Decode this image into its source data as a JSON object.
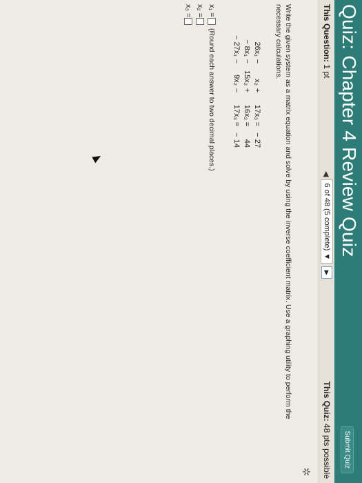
{
  "header": {
    "title": "Quiz: Chapter 4 Review Quiz",
    "submit_label": "Submit Quiz"
  },
  "status": {
    "question_label": "This Question:",
    "question_points": "1 pt",
    "position_text": "6 of 48 (5 complete)",
    "quiz_label": "This Quiz:",
    "quiz_points": "48 pts possible"
  },
  "question": {
    "instructions": "Write the given system as a matrix equation and solve by using the inverse coefficient matrix. Use a graphing utility to perform the necessary calculations.",
    "equations": [
      {
        "c1": "26x₁",
        "op1": "−",
        "c2": "x₂",
        "op2": "+",
        "c3": "17x₃",
        "eq": "=",
        "rhs": "− 27"
      },
      {
        "c1": "− 8x₁",
        "op1": "−",
        "c2": "15x₂",
        "op2": "+",
        "c3": "16x₃",
        "eq": "=",
        "rhs": "44"
      },
      {
        "c1": "− 27x₁",
        "op1": "−",
        "c2": "9x₂",
        "op2": "−",
        "c3": "17x₃",
        "eq": "=",
        "rhs": "− 14"
      }
    ],
    "answers": [
      {
        "label": "x₁ =",
        "value": ""
      },
      {
        "label": "x₂ =",
        "value": ""
      },
      {
        "label": "x₃ =",
        "value": ""
      }
    ],
    "round_note": "(Round each answer to two decimal places.)"
  },
  "icons": {
    "gear": "gear-icon",
    "prev": "triangle-left-icon",
    "dropdown": "triangle-down-icon",
    "next": "triangle-right-icon",
    "cursor": "mouse-pointer-icon"
  },
  "colors": {
    "header_bg": "#2e7c78",
    "page_bg": "#efece6"
  }
}
